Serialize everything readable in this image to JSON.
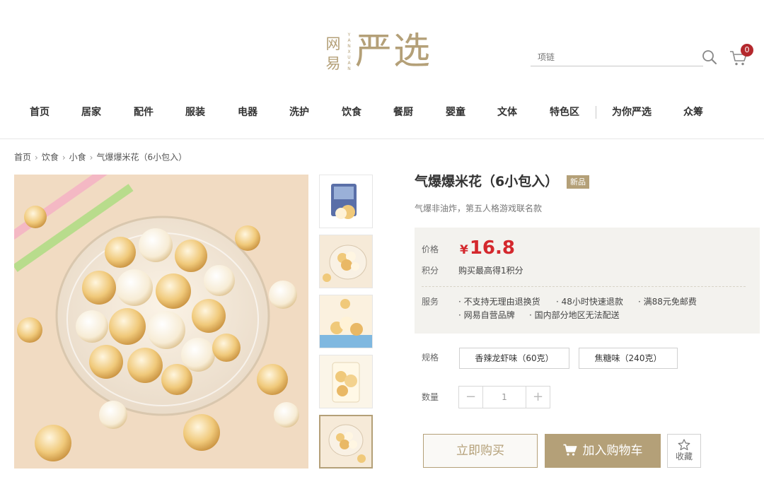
{
  "logo": {
    "wangyi": "网易",
    "vertical": "YANXUAN",
    "yanxuan": "严选"
  },
  "search": {
    "placeholder": "项链"
  },
  "cart": {
    "count": "0"
  },
  "nav": [
    "首页",
    "居家",
    "配件",
    "服装",
    "电器",
    "洗护",
    "饮食",
    "餐厨",
    "婴童",
    "文体",
    "特色区",
    "为你严选",
    "众筹"
  ],
  "breadcrumb": [
    "首页",
    "饮食",
    "小食",
    "气爆爆米花（6小包入）"
  ],
  "product": {
    "title": "气爆爆米花（6小包入）",
    "tag": "新品",
    "subtitle": "气爆非油炸，第五人格游戏联名款",
    "price_label": "价格",
    "currency": "¥",
    "price": "16.8",
    "points_label": "积分",
    "points_text": "购买最高得1积分",
    "service_label": "服务",
    "services": [
      "· 不支持无理由退换货",
      "· 48小时快速退款",
      "· 满88元免邮费",
      "· 网易自营品牌",
      "· 国内部分地区无法配送"
    ],
    "spec_label": "规格",
    "specs": [
      "香辣龙虾味（60克）",
      "焦糖味（240克）"
    ],
    "qty_label": "数量",
    "qty": "1",
    "minus": "−",
    "plus": "+",
    "buy_now": "立即购买",
    "add_cart": "加入购物车",
    "fav": "收藏"
  },
  "colors": {
    "accent": "#b4a078",
    "price": "#d4282d",
    "badge": "#b4282d"
  }
}
